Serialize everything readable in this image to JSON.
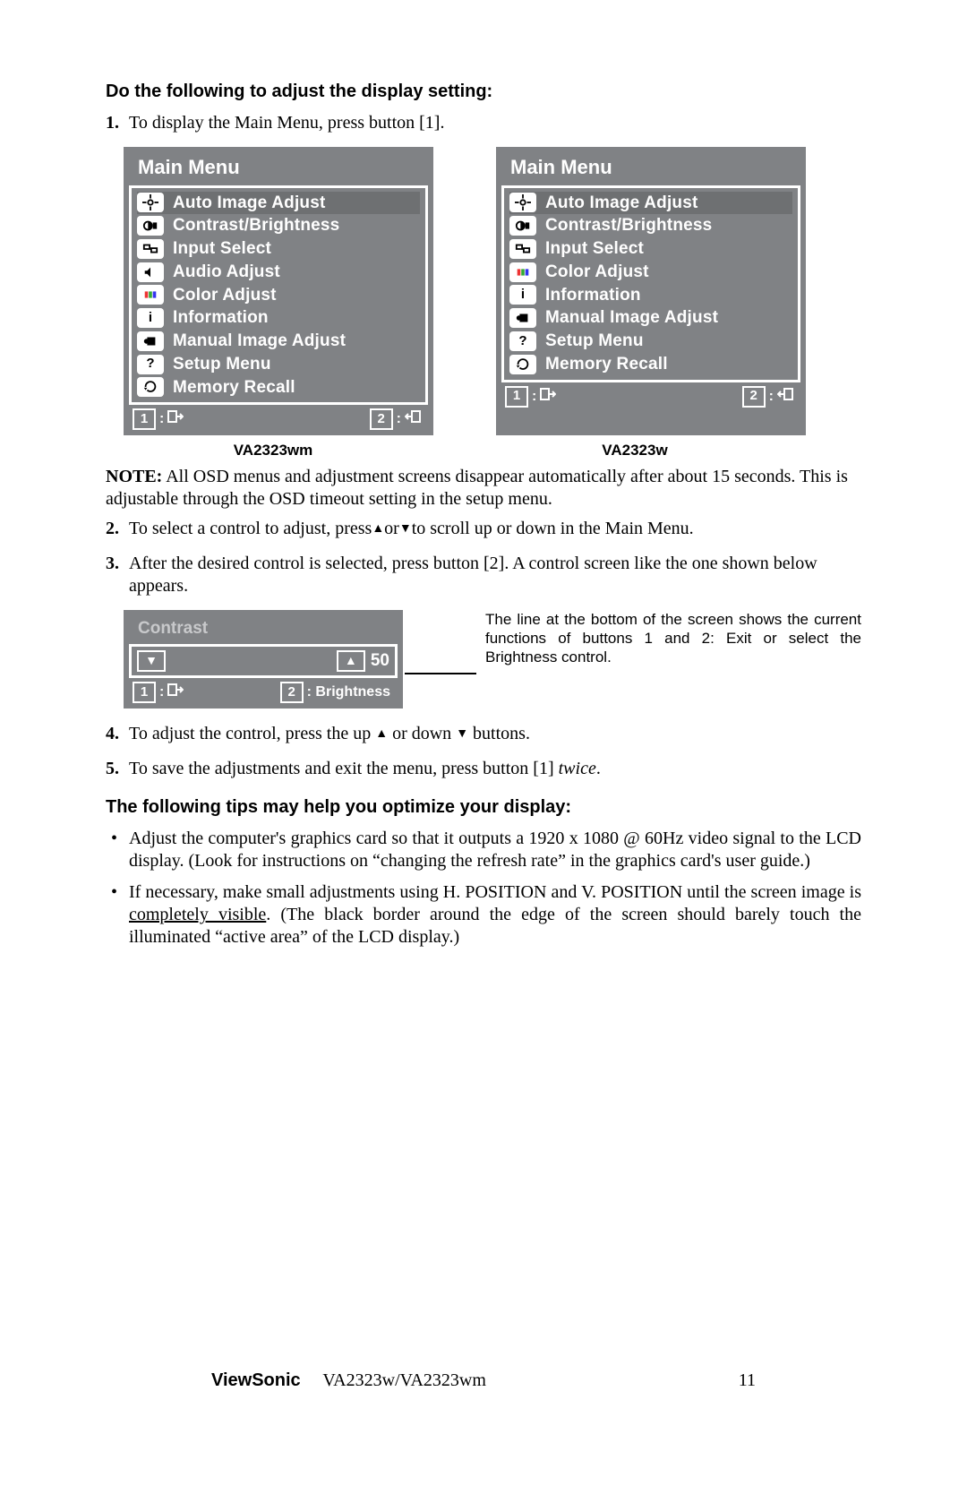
{
  "heading1": "Do the following to adjust the display setting:",
  "step1_num": "1.",
  "step1_text": "To display the Main Menu, press button [1].",
  "menu_title": "Main Menu",
  "menu_wm_items": [
    "Auto Image Adjust",
    "Contrast/Brightness",
    "Input Select",
    "Audio Adjust",
    "Color Adjust",
    "Information",
    "Manual Image Adjust",
    "Setup Menu",
    "Memory Recall"
  ],
  "menu_w_items": [
    "Auto Image Adjust",
    "Contrast/Brightness",
    "Input Select",
    "Color Adjust",
    "Information",
    "Manual Image Adjust",
    "Setup Menu",
    "Memory Recall"
  ],
  "foot1": "1",
  "foot2": "2",
  "caption_wm": "VA2323wm",
  "caption_w": "VA2323w",
  "note_label": "NOTE:",
  "note_text": " All OSD menus and adjustment screens disappear automatically after about 15 seconds. This is adjustable through the OSD timeout setting in the setup menu.",
  "step2_num": "2.",
  "step2_text_a": "To select a control to adjust, press",
  "step2_text_b": "or",
  "step2_text_c": "to scroll up or down in the Main Menu.",
  "step3_num": "3.",
  "step3_text": "After the desired control is selected, press button [2]. A control screen like the one shown below appears.",
  "contrast_title": "Contrast",
  "contrast_value": "50",
  "contrast_foot_label": ": Brightness",
  "contrast_note": "The line at the bottom of the screen shows the current functions of buttons 1 and 2: Exit or select the Brightness control.",
  "step4_num": "4.",
  "step4_text_a": "To adjust the control, press the up ",
  "step4_text_b": " or down ",
  "step4_text_c": " buttons.",
  "step5_num": "5.",
  "step5_text_a": "To save the adjustments and exit the menu, press button [1] ",
  "step5_text_b": "twice",
  "step5_text_c": ".",
  "heading2": "The following tips may help you optimize your display:",
  "tip1": "Adjust the computer's graphics card so that it outputs a 1920 x 1080 @ 60Hz video signal to the LCD display. (Look for instructions on “changing the refresh rate” in the graphics card's user guide.)",
  "tip2_a": "If necessary, make small adjustments using H. POSITION and V. POSITION until the screen image is ",
  "tip2_u": "completely visible",
  "tip2_b": ". (The black border around the edge of the screen should barely touch the illuminated “active area” of the LCD display.)",
  "footer_brand": "ViewSonic",
  "footer_model": "VA2323w/VA2323wm",
  "page_num": "11"
}
